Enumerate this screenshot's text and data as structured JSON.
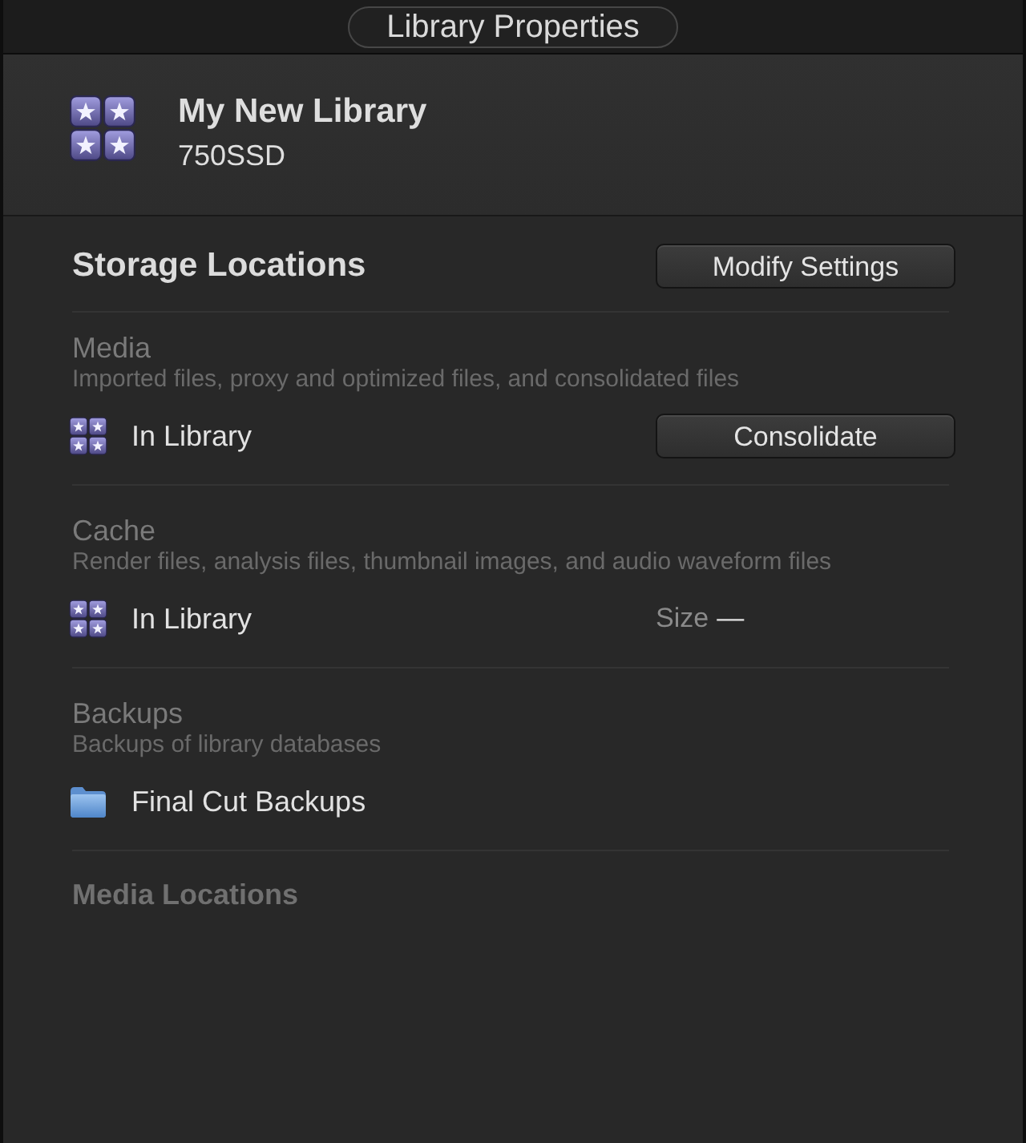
{
  "window": {
    "title": "Library Properties"
  },
  "library": {
    "name": "My New Library",
    "volume": "750SSD"
  },
  "storage": {
    "title": "Storage Locations",
    "button": "Modify Settings",
    "sections": [
      {
        "title": "Media",
        "description": "Imported files, proxy and optimized files, and consolidated files",
        "location": {
          "kind": "library",
          "label": "In Library"
        },
        "action": {
          "kind": "button",
          "label": "Consolidate"
        }
      },
      {
        "title": "Cache",
        "description": "Render files, analysis files, thumbnail images, and audio waveform files",
        "location": {
          "kind": "library",
          "label": "In Library"
        },
        "action": {
          "kind": "size",
          "label": "Size",
          "value": "—"
        }
      },
      {
        "title": "Backups",
        "description": "Backups of library databases",
        "location": {
          "kind": "folder",
          "label": "Final Cut Backups"
        }
      }
    ]
  },
  "media_locations": {
    "title": "Media Locations"
  }
}
